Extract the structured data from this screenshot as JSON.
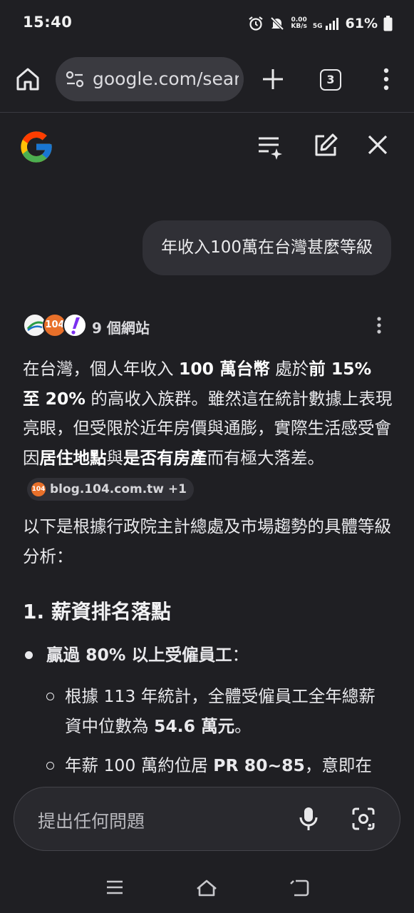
{
  "status_bar": {
    "time": "15:40",
    "net_speed_top": "0.00",
    "net_speed_bottom": "KB/s",
    "network": "5G",
    "battery": "61%"
  },
  "browser": {
    "url": "google.com/search",
    "tab_count": "3"
  },
  "query": "年收入100萬在台灣甚麼等級",
  "sources": {
    "label": "9 個網站",
    "favicon_text": "104"
  },
  "answer": {
    "p1_a": "在台灣，個人年收入 ",
    "p1_b": "100 萬台幣",
    "p1_c": " 處於",
    "p1_d": "前 15% 至 20%",
    "p1_e": " 的高收入族群。雖然這在統計數據上表現亮眼，但受限於近年房價與通膨，實際生活感受會因",
    "p1_f": "居住地點",
    "p1_g": "與",
    "p1_h": "是否有房產",
    "p1_i": "而有極大落差。",
    "chip_label": "blog.104.com.tw +1",
    "chip_fav": "104",
    "p2": "以下是根據行政院主計總處及市場趨勢的具體等級分析：",
    "heading": "1. 薪資排名落點",
    "bullet_bold": "贏過 80% 以上受僱員工",
    "bullet_tail": "：",
    "sub1_a": "根據 113 年統計，全體受僱員工全年總薪資中位數為 ",
    "sub1_b": "54.6 萬元",
    "sub1_c": "。",
    "sub2_a": "年薪 100 萬約位居 ",
    "sub2_b": "PR 80~85",
    "sub2_c": "，意即在"
  },
  "ask": {
    "placeholder": "提出任何問題"
  }
}
